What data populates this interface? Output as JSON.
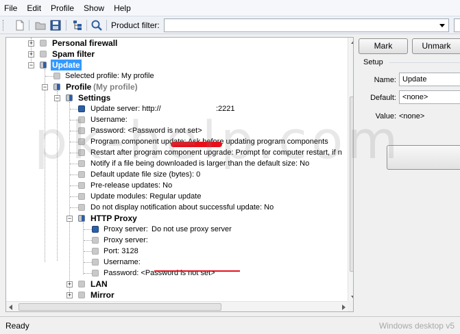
{
  "menu": [
    "File",
    "Edit",
    "Profile",
    "Show",
    "Help"
  ],
  "toolbar": {
    "filter_label": "Product filter:",
    "filter_value": ""
  },
  "tree": {
    "personal_firewall": "Personal firewall",
    "spam_filter": "Spam filter",
    "update": "Update",
    "selected_profile": "Selected profile: My profile",
    "profile": "Profile",
    "profile_name": "(My profile)",
    "settings": "Settings",
    "update_server_label": "Update server: http://",
    "update_server_port": ":2221",
    "username": "Username:",
    "password": "Password: <Password is not set>",
    "program_component_update": "Program component update: Ask before updating program components",
    "restart_after_upgrade": "Restart after program component upgrade: Prompt for computer restart, if n",
    "notify_large_file": "Notify if a file being downloaded is larger than the default size: No",
    "default_update_file_size": "Default update file size (bytes): 0",
    "prerelease_updates": "Pre-release updates: No",
    "update_modules": "Update modules: Regular update",
    "no_notification": "Do not display notification about successful update: No",
    "http_proxy": "HTTP Proxy",
    "proxy_server_label": "Proxy server: ",
    "proxy_server_value": "Do not use proxy server",
    "proxy_server_empty": "Proxy server:",
    "port": "Port: 3128",
    "proxy_username": "Username:",
    "proxy_password": "Password: <Password is not set>",
    "lan": "LAN",
    "mirror": "Mirror"
  },
  "right_panel": {
    "mark_button": "Mark",
    "unmark_button": "Unmark",
    "setup_title": "Setup",
    "name_label": "Name:",
    "name_value": "Update",
    "default_label": "Default:",
    "default_value": "<none>",
    "value_label": "Value:",
    "value_value": "<none>"
  },
  "status": {
    "left": "Ready",
    "right": "Windows desktop v5"
  },
  "watermark": "pk-help.com",
  "colors": {
    "selection": "#3399ff",
    "check_blue": "#2c5fa8",
    "highlight_red": "#e8101b"
  }
}
